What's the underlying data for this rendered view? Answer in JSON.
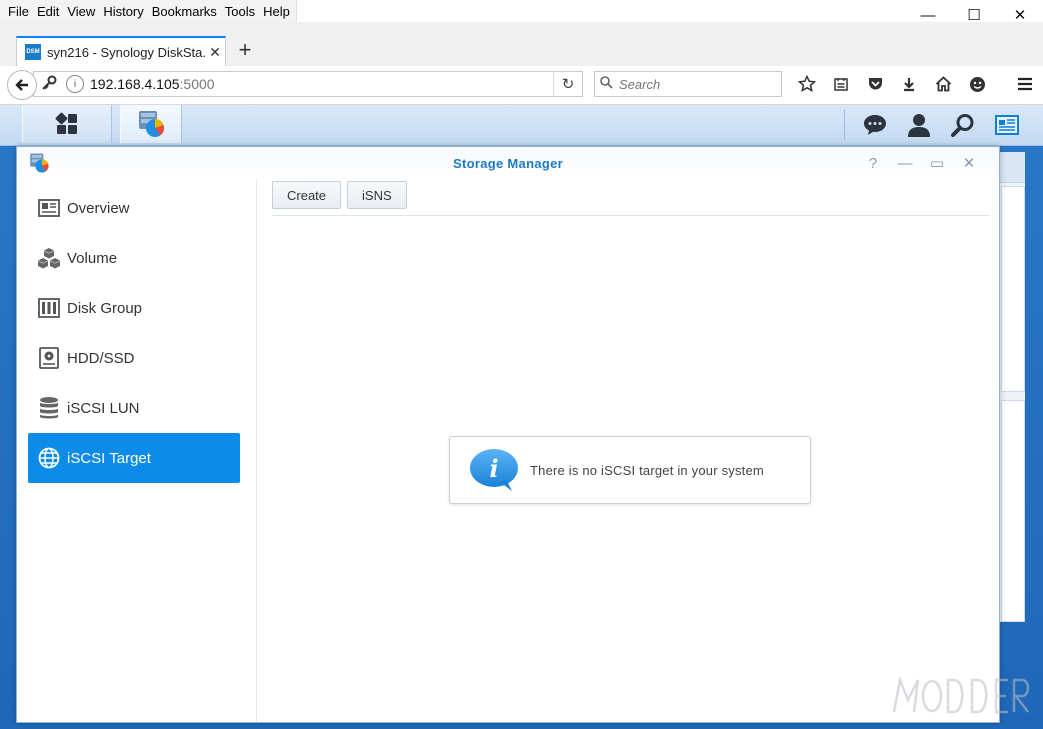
{
  "browser": {
    "menu": [
      "File",
      "Edit",
      "View",
      "History",
      "Bookmarks",
      "Tools",
      "Help"
    ],
    "window_controls": {
      "minimize": "—",
      "maximize": "☐",
      "close": "✕"
    },
    "tab": {
      "favicon_text": "DSM",
      "title": "syn216 - Synology DiskSta...",
      "close": "✕"
    },
    "new_tab": "+",
    "url": {
      "host": "192.168.4.105",
      "port": ":5000"
    },
    "search_placeholder": "Search",
    "reload": "↻"
  },
  "window": {
    "title": "Storage Manager",
    "controls": {
      "help": "?",
      "minimize": "—",
      "maximize": "▭",
      "close": "✕"
    }
  },
  "sidebar": {
    "items": [
      {
        "label": "Overview",
        "icon": "overview-icon"
      },
      {
        "label": "Volume",
        "icon": "volume-icon"
      },
      {
        "label": "Disk Group",
        "icon": "disk-group-icon"
      },
      {
        "label": "HDD/SSD",
        "icon": "hdd-icon"
      },
      {
        "label": "iSCSI LUN",
        "icon": "database-icon"
      },
      {
        "label": "iSCSI Target",
        "icon": "globe-icon",
        "active": true
      }
    ]
  },
  "toolbar": {
    "create": "Create",
    "isns": "iSNS"
  },
  "empty_message": "There is no iSCSI target in your system",
  "colors": {
    "accent": "#0c8be9",
    "title": "#1a7bc4",
    "desktop": "#2a77c8"
  }
}
